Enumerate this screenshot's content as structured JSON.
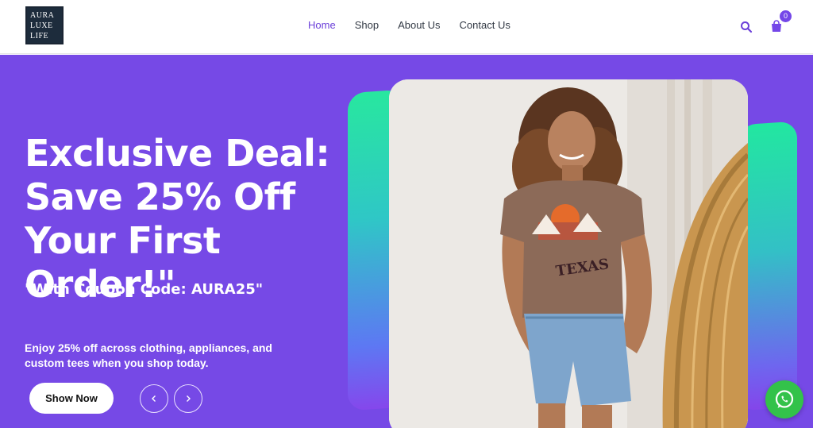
{
  "header": {
    "logo": {
      "lines": [
        "AURA",
        "LUXE",
        "LIFE"
      ]
    },
    "nav": [
      {
        "label": "Home",
        "active": true
      },
      {
        "label": "Shop",
        "active": false
      },
      {
        "label": "About Us",
        "active": false
      },
      {
        "label": "Contact Us",
        "active": false
      }
    ],
    "search_icon": "search-icon",
    "cart_icon": "shopping-bag-icon",
    "cart_count": "0"
  },
  "hero": {
    "headline": "Exclusive Deal: Save 25% Off Your First Order!\"",
    "coupon": "\"With Coupon Code: AURA25\"",
    "description": "Enjoy 25% off across clothing, appliances, and custom tees when you shop today.",
    "cta_label": "Show Now",
    "prev_icon": "chevron-left-icon",
    "next_icon": "chevron-right-icon",
    "photo_shirt_text": "TEXAS"
  },
  "colors": {
    "accent": "#7649e6",
    "nav_active": "#6b3fd9",
    "deco_gradient_top": "#28e79f",
    "whatsapp": "#33c24a"
  },
  "floating": {
    "whatsapp_icon": "whatsapp-icon"
  }
}
